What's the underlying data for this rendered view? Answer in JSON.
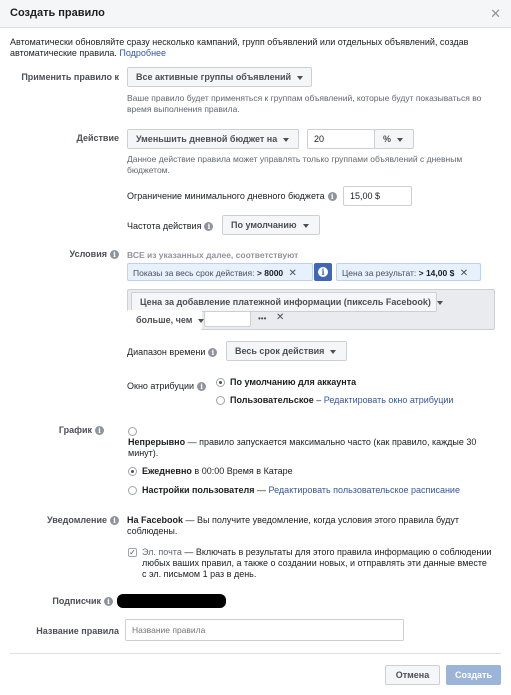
{
  "dialog": {
    "title": "Создать правило",
    "close_icon": "close-icon"
  },
  "intro": {
    "text": "Автоматически обновляйте сразу несколько кампаний, групп объявлений или отдельных объявлений, создав автоматические правила.",
    "link": "Подробнее"
  },
  "apply": {
    "label": "Применить правило к",
    "value": "Все активные группы объявлений",
    "hint": "Ваше правило будет применяться к группам объявлений, которые будут показываться во время выполнения правила."
  },
  "action": {
    "label": "Действие",
    "value": "Уменьшить дневной бюджет на",
    "amount": "20",
    "unit": "%",
    "hint": "Данное действие правила может управлять только группами объявлений с дневным бюджетом.",
    "min_budget_label": "Ограничение минимального дневного бюджета",
    "min_budget_value": "15,00 $",
    "frequency_label": "Частота действия",
    "frequency_value": "По умолчанию"
  },
  "conditions": {
    "label": "Условия",
    "match_text": "ВСЕ из указанных далее, соответствуют",
    "chip1": {
      "label": "Показы за весь срок действия:",
      "op": ">",
      "value": "8000"
    },
    "chip2": {
      "label": "Цена за результат:",
      "op": ">",
      "value": "14,00 $"
    },
    "metric": "Цена за добавление платежной информации (пиксель Facebook)",
    "operator": "больше, чем",
    "value_input": "",
    "more": "•••",
    "time_range_label": "Диапазон времени",
    "time_range_value": "Весь срок действия",
    "attribution_label": "Окно атрибуции",
    "attribution_default": "По умолчанию для аккаунта",
    "attribution_custom": "Пользовательское",
    "attribution_custom_link": "Редактировать окно атрибуции"
  },
  "schedule": {
    "label": "График",
    "continuous_title": "Непрерывно",
    "continuous_desc": " — правило запускается максимально часто (как правило, каждые 30 минут).",
    "daily_title": "Ежедневно",
    "daily_desc": " в 00:00 Время в Катаре",
    "custom_title": "Настройки пользователя",
    "custom_sep": " — ",
    "custom_link": "Редактировать пользовательское расписание"
  },
  "notification": {
    "label": "Уведомление",
    "fb_title": "На Facebook",
    "fb_desc": " — Вы получите уведомление, когда условия этого правила будут соблюдены.",
    "email_title": "Эл. почта",
    "email_desc": " — Включать в результаты для этого правила информацию о соблюдении любых ваших правил, а также о создании новых, и отправлять эти данные вместе с эл. письмом 1 раз в день."
  },
  "subscriber": {
    "label": "Подписчик"
  },
  "rule_name": {
    "label": "Название правила",
    "placeholder": "Название правила"
  },
  "footer": {
    "cancel": "Отмена",
    "create": "Создать"
  },
  "colors": {
    "accent": "#4267b2",
    "link": "#365899",
    "create_disabled": "#9cb4d8"
  }
}
